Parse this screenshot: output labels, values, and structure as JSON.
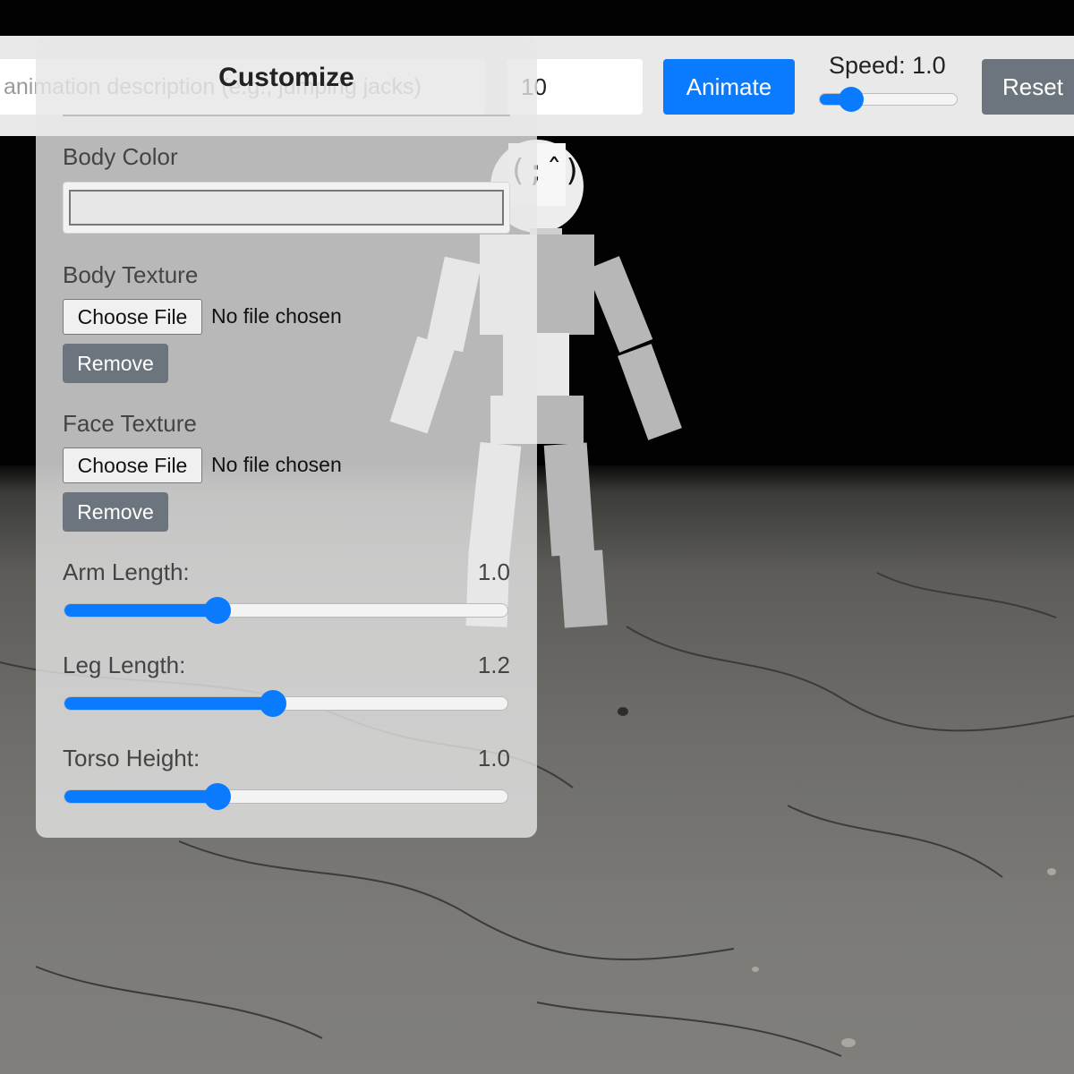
{
  "toolbar": {
    "description_placeholder": "animation description (e.g., jumping jacks)",
    "duration_value": "10",
    "animate_label": "Animate",
    "speed_label": "Speed: 1.0",
    "speed_level": 0.23,
    "reset_label": "Reset"
  },
  "panel": {
    "title": "Customize",
    "body_color_label": "Body Color",
    "body_color_value": "#e6e6e6",
    "body_texture": {
      "label": "Body Texture",
      "choose_label": "Choose File",
      "status": "No file chosen",
      "remove_label": "Remove"
    },
    "face_texture": {
      "label": "Face Texture",
      "choose_label": "Choose File",
      "status": "No file chosen",
      "remove_label": "Remove"
    },
    "sliders": [
      {
        "label": "Arm Length:",
        "value": "1.0",
        "level": 0.345
      },
      {
        "label": "Leg Length:",
        "value": "1.2",
        "level": 0.47
      },
      {
        "label": "Torso Height:",
        "value": "1.0",
        "level": 0.345
      }
    ]
  },
  "colors": {
    "accent": "#0a7bff",
    "secondary_button": "#6c757d",
    "toolbar_bg": "#e9e9e9"
  },
  "icons": {
    "face": "face-texture-icon"
  }
}
